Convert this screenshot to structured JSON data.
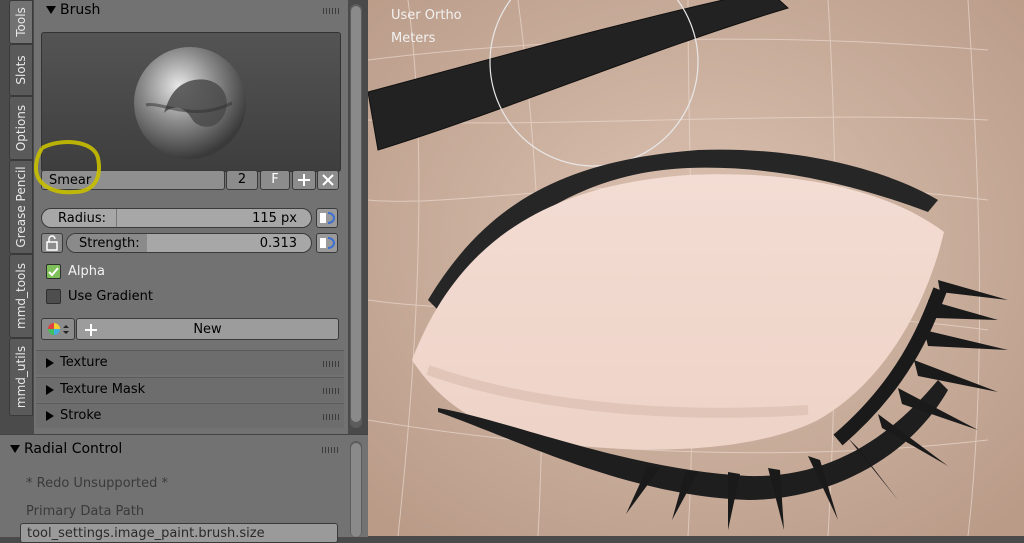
{
  "sidebar_tabs": [
    {
      "label": "Tools",
      "active": true
    },
    {
      "label": "Slots"
    },
    {
      "label": "Options"
    },
    {
      "label": "Grease Pencil"
    },
    {
      "label": "mmd_tools"
    },
    {
      "label": "mmd_utils"
    }
  ],
  "brush_panel": {
    "title": "Brush",
    "brush_name": "Smear",
    "users_count": "2",
    "fake_user_label": "F",
    "radius": {
      "label": "Radius:",
      "value": "115 px"
    },
    "strength": {
      "label": "Strength:",
      "value": "0.313"
    },
    "alpha": {
      "label": "Alpha",
      "checked": true
    },
    "use_gradient": {
      "label": "Use Gradient",
      "checked": false
    },
    "new_button": "New"
  },
  "subpanels": [
    {
      "label": "Texture"
    },
    {
      "label": "Texture Mask"
    },
    {
      "label": "Stroke"
    }
  ],
  "radial_control": {
    "title": "Radial Control",
    "redo_text": "* Redo Unsupported *",
    "primary_label": "Primary Data Path",
    "primary_value": "tool_settings.image_paint.brush.size"
  },
  "viewport": {
    "view_label": "User Ortho",
    "units_label": "Meters"
  },
  "colors": {
    "highlight": "#c8c000",
    "check": "#7fbf5a"
  }
}
